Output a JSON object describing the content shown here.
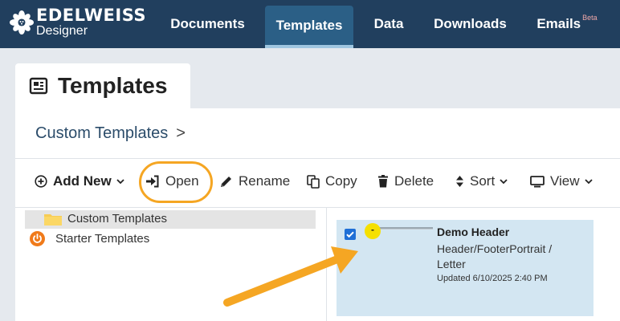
{
  "app": {
    "brand": "EDELWEISS",
    "sub": "Designer"
  },
  "nav": {
    "tabs": [
      {
        "label": "Documents"
      },
      {
        "label": "Templates"
      },
      {
        "label": "Data"
      },
      {
        "label": "Downloads"
      },
      {
        "label": "Emails"
      }
    ],
    "beta_label": "Beta"
  },
  "page": {
    "title": "Templates"
  },
  "breadcrumb": {
    "current": "Custom Templates",
    "separator": ">"
  },
  "toolbar": {
    "add_new": "Add New",
    "open": "Open",
    "rename": "Rename",
    "copy": "Copy",
    "delete": "Delete",
    "sort": "Sort",
    "view": "View"
  },
  "tree": {
    "items": [
      {
        "label": "Custom Templates",
        "icon": "folder-icon",
        "selected": true
      },
      {
        "label": "Starter Templates",
        "icon": "power-icon",
        "selected": false
      }
    ]
  },
  "card": {
    "title": "Demo Header",
    "subtitle": "Header/FooterPortrait / Letter",
    "updated": "Updated 6/10/2025 2:40 PM",
    "checked": true,
    "marker": "-"
  },
  "colors": {
    "nav_bg": "#213f5e",
    "nav_active": "#2b5f86",
    "highlight": "#f5a623",
    "card_bg": "#d3e6f2",
    "checkbox": "#1f6fd6"
  }
}
